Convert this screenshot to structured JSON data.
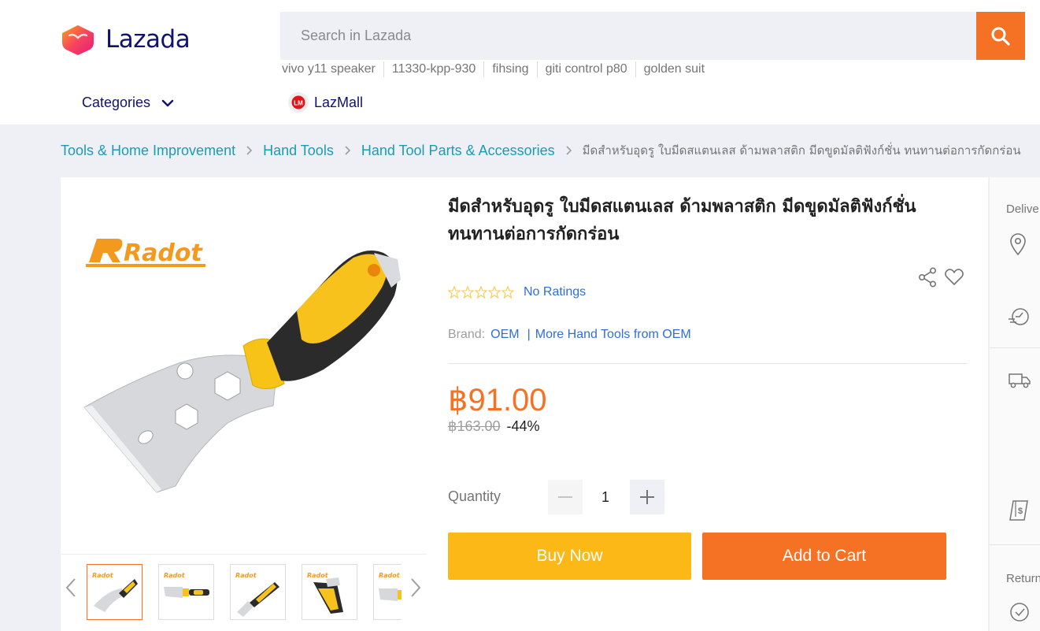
{
  "header": {
    "logo_text": "Lazada",
    "search_placeholder": "Search in Lazada",
    "suggestions": [
      "vivo y11 speaker",
      "11330-kpp-930",
      "fihsing",
      "giti control p80",
      "golden suit"
    ],
    "categories_label": "Categories",
    "lazmall_label": "LazMall",
    "lazmall_badge": "LM"
  },
  "breadcrumb": {
    "items": [
      "Tools & Home Improvement",
      "Hand Tools",
      "Hand Tool Parts & Accessories"
    ],
    "current": "มีดสำหรับอุดรู ใบมีดสแตนเลส ด้ามพลาสติก มีดขูดมัลติฟังก์ชั่น ทนทานต่อการกัดกร่อน"
  },
  "gallery": {
    "brand_watermark": "Radot",
    "thumbnail_count": 5,
    "active_thumbnail": 1
  },
  "product": {
    "title": "มีดสำหรับอุดรู ใบมีดสแตนเลส ด้ามพลาสติก มีดขูดมัลติฟังก์ชั่น ทนทานต่อการกัดกร่อน",
    "rating_stars": 0,
    "ratings_text": "No Ratings",
    "brand_label": "Brand:",
    "brand_name": "OEM",
    "brand_separator": "|",
    "more_from": "More Hand Tools from OEM",
    "price": "฿91.00",
    "original_price": "฿163.00",
    "discount": "-44%",
    "quantity_label": "Quantity",
    "quantity": "1",
    "buy_now": "Buy Now",
    "add_to_cart": "Add to Cart"
  },
  "side_panel": {
    "delivery_heading": "Delive",
    "returns_heading": "Return"
  },
  "colors": {
    "accent": "#f57224",
    "buy_now": "#fbb817",
    "link": "#2f6fd6",
    "breadcrumb": "#1a9cb7",
    "brand_navy": "#0f136d"
  }
}
